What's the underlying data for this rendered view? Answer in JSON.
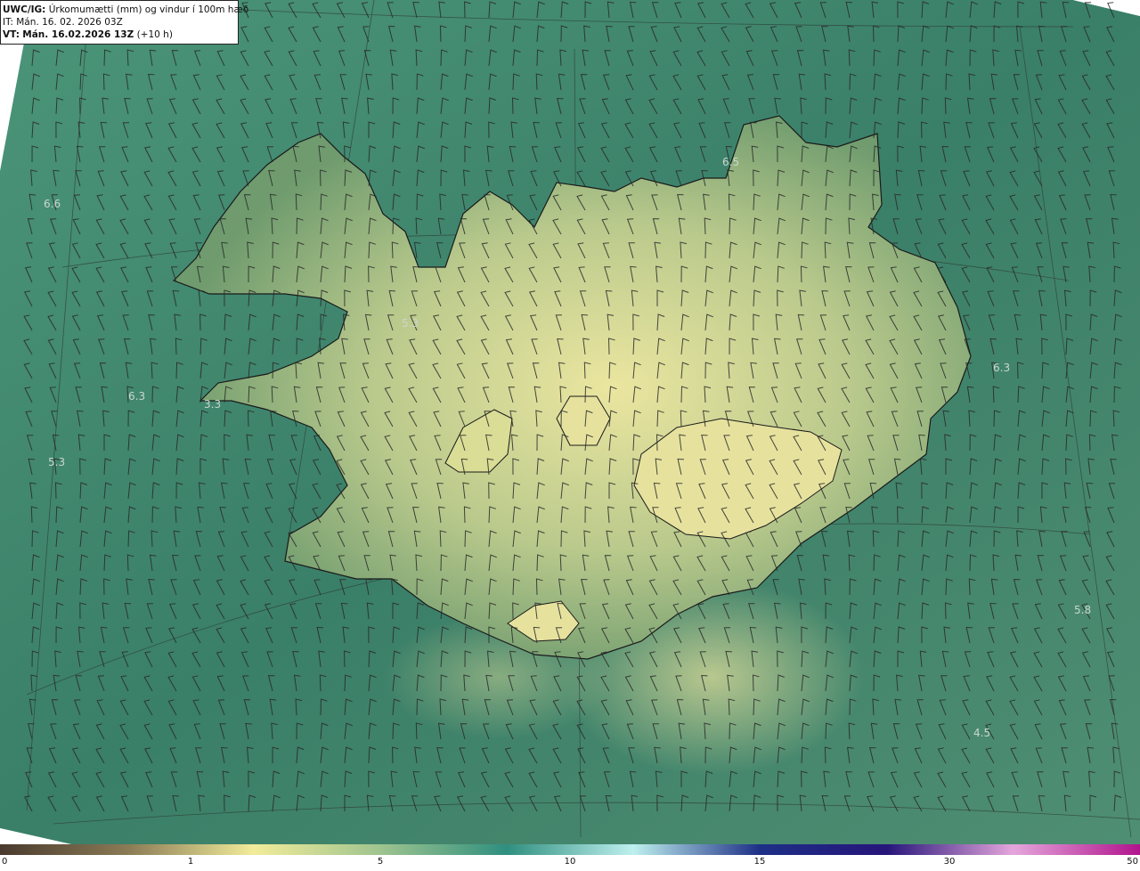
{
  "header": {
    "product_code": "UWC/IG:",
    "product_desc": "Úrkomumætti (mm) og vindur í 100m hæð",
    "init_label": "IT:",
    "init_time": "Mán. 16. 02. 2026 03Z",
    "valid_label": "VT:",
    "valid_time": "Mán. 16.02.2026 13Z",
    "lead_time": "(+10 h)"
  },
  "value_labels": [
    "6.6",
    "6.5",
    "5.3",
    "6.3",
    "3.3",
    "6.3",
    "5.3",
    "5.8",
    "4.5"
  ],
  "colorbar": {
    "ticks": [
      "0",
      "1",
      "5",
      "10",
      "15",
      "30",
      "50"
    ],
    "colors": [
      "#4a3a2e",
      "#8a7a55",
      "#f2ec9a",
      "#9fc48f",
      "#2f8f7f",
      "#bff0ef",
      "#1d2f86",
      "#26157a",
      "#e5a6dc",
      "#b0148c"
    ]
  },
  "colors": {
    "sea": "#3f8a6f",
    "land_low": "#6a9a6c",
    "land_high": "#e9e59a",
    "coastline": "#1a1a1a"
  }
}
